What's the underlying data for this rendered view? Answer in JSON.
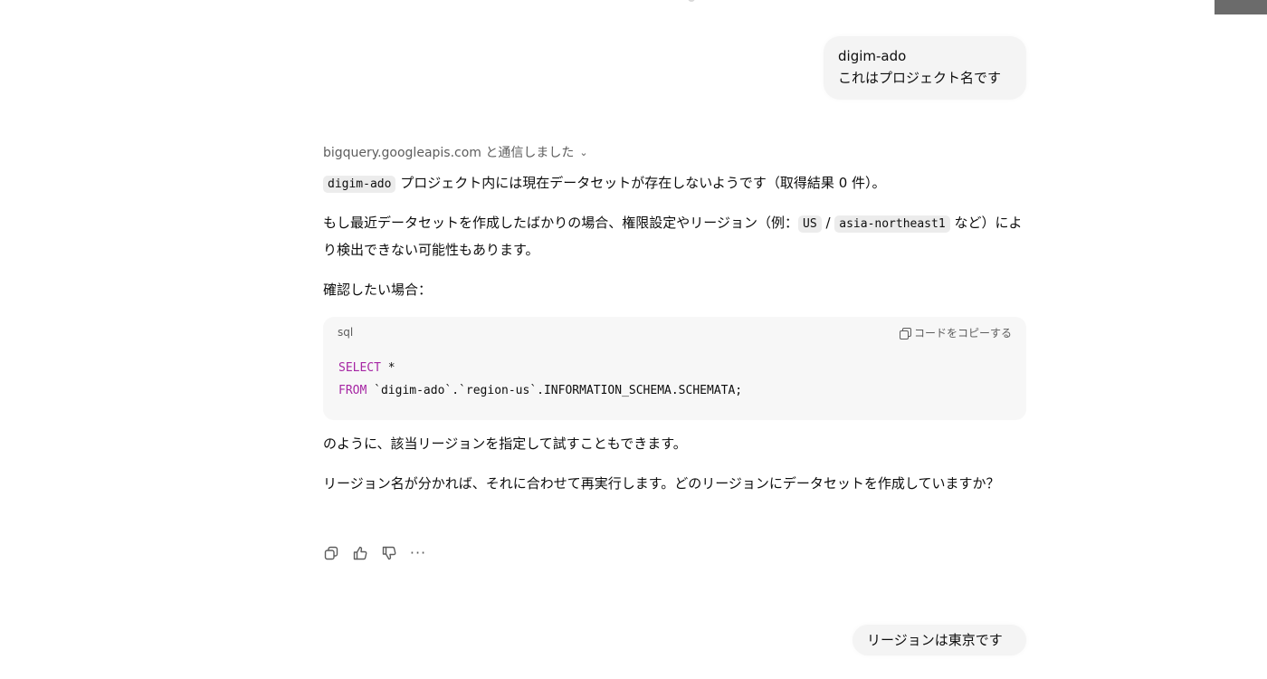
{
  "messages": {
    "user1": {
      "line1": "digim-ado",
      "line2": "これはプロジェクト名です"
    },
    "assistant": {
      "tool_status": "bigquery.googleapis.com と通信しました",
      "p1": {
        "code": "digim-ado",
        "text": " プロジェクト内には現在データセットが存在しないようです（取得結果 0 件）。"
      },
      "p2": {
        "before": "もし最近データセットを作成したばかりの場合、権限設定やリージョン（例：",
        "code1": "US",
        "sep": " / ",
        "code2": "asia-northeast1",
        "after": " など）により検出できない可能性もあります。"
      },
      "p3": "確認したい場合：",
      "code_block": {
        "lang": "sql",
        "copy_label": "コードをコピーする",
        "line1_kw": "SELECT",
        "line1_rest": " *",
        "line2_kw": "FROM",
        "line2_rest": " `digim-ado`.`region-us`.INFORMATION_SCHEMA.SCHEMATA;"
      },
      "p4": "のように、該当リージョンを指定して試すこともできます。",
      "p5": "リージョン名が分かれば、それに合わせて再実行します。どのリージョンにデータセットを作成していますか？",
      "actions": [
        "copy-icon",
        "thumbs-up-icon",
        "thumbs-down-icon",
        "more-icon"
      ],
      "more_label": "···"
    },
    "user2": "リージョンは東京です"
  }
}
